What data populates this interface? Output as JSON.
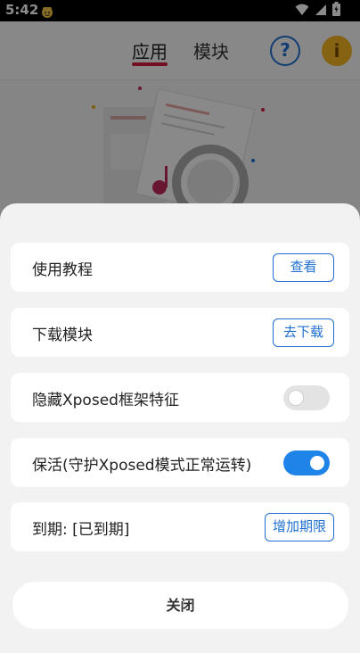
{
  "status_bar": {
    "time": "5:42",
    "notification_icon": "face-emoji-icon",
    "system_icons": [
      "wifi-icon",
      "signal-icon",
      "battery-icon"
    ]
  },
  "background_app": {
    "tabs": [
      {
        "label": "应用",
        "active": true
      },
      {
        "label": "模块",
        "active": false
      }
    ],
    "help_icon": "?",
    "info_icon": "i",
    "accent_color": "#d01d3e"
  },
  "sheet": {
    "items": [
      {
        "label": "使用教程",
        "control": "button",
        "button_label": "查看"
      },
      {
        "label": "下载模块",
        "control": "button",
        "button_label": "去下载"
      },
      {
        "label": "隐藏Xposed框架特征",
        "control": "toggle",
        "checked": false
      },
      {
        "label": "保活(守护Xposed模式正常运转)",
        "control": "toggle",
        "checked": true
      },
      {
        "label": "到期: [已到期]",
        "control": "button",
        "button_label": "增加期限"
      }
    ],
    "close_label": "关闭"
  },
  "colors": {
    "primary": "#1f6fd0",
    "toggle_on": "#1f84e8",
    "toggle_off": "#e3e3e3"
  }
}
